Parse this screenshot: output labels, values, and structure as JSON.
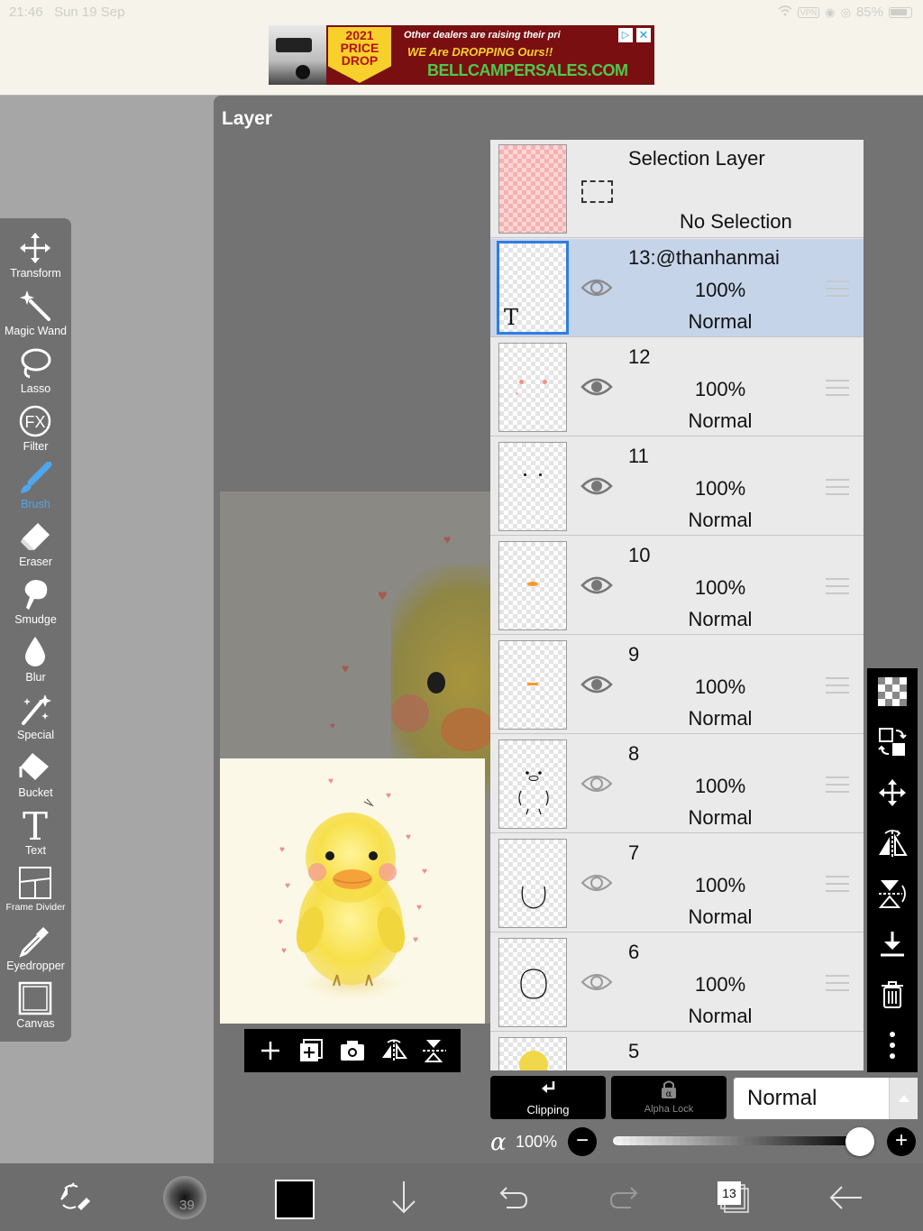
{
  "status_bar": {
    "time": "21:46",
    "date": "Sun 19 Sep",
    "battery": "85%",
    "vpn": "VPN"
  },
  "ad": {
    "badge_year": "2021",
    "badge_line2": "PRICE",
    "badge_line3": "DROP",
    "line1": "Other dealers are raising their pri",
    "line2": "WE Are DROPPING Ours!!",
    "line3": "BELLCAMPERSALES.COM"
  },
  "tools": [
    {
      "label": "Transform",
      "icon": "transform-icon"
    },
    {
      "label": "Magic Wand",
      "icon": "magic-wand-icon"
    },
    {
      "label": "Lasso",
      "icon": "lasso-icon"
    },
    {
      "label": "Filter",
      "icon": "filter-icon",
      "glyph": "FX"
    },
    {
      "label": "Brush",
      "icon": "brush-icon",
      "active": true
    },
    {
      "label": "Eraser",
      "icon": "eraser-icon"
    },
    {
      "label": "Smudge",
      "icon": "smudge-icon"
    },
    {
      "label": "Blur",
      "icon": "blur-icon"
    },
    {
      "label": "Special",
      "icon": "special-icon"
    },
    {
      "label": "Bucket",
      "icon": "bucket-icon"
    },
    {
      "label": "Text",
      "icon": "text-icon",
      "glyph": "T"
    },
    {
      "label": "Frame Divider",
      "icon": "frame-divider-icon"
    },
    {
      "label": "Eyedropper",
      "icon": "eyedropper-icon"
    },
    {
      "label": "Canvas",
      "icon": "canvas-icon"
    }
  ],
  "layer_panel": {
    "title": "Layer"
  },
  "selection_layer": {
    "name": "Selection Layer",
    "status": "No Selection"
  },
  "layers": [
    {
      "name": "13:@thanhanmai",
      "opacity": "100%",
      "mode": "Normal",
      "visible": true,
      "selected": true,
      "thumb_glyph": "T"
    },
    {
      "name": "12",
      "opacity": "100%",
      "mode": "Normal",
      "visible": true
    },
    {
      "name": "11",
      "opacity": "100%",
      "mode": "Normal",
      "visible": true
    },
    {
      "name": "10",
      "opacity": "100%",
      "mode": "Normal",
      "visible": true
    },
    {
      "name": "9",
      "opacity": "100%",
      "mode": "Normal",
      "visible": true
    },
    {
      "name": "8",
      "opacity": "100%",
      "mode": "Normal",
      "visible": false
    },
    {
      "name": "7",
      "opacity": "100%",
      "mode": "Normal",
      "visible": false
    },
    {
      "name": "6",
      "opacity": "100%",
      "mode": "Normal",
      "visible": false
    },
    {
      "name": "5",
      "opacity": "",
      "mode": "",
      "visible": false
    }
  ],
  "blend": {
    "clipping_label": "Clipping",
    "alpha_lock_label": "Alpha Lock",
    "alpha_lock_glyph": "α",
    "mode": "Normal",
    "alpha_symbol": "α",
    "opacity_label": "100%",
    "opacity": 1.0,
    "minus": "−",
    "plus": "+"
  },
  "bottom_bar": {
    "brush_size": "39",
    "layer_count": "13",
    "color": "#000000"
  },
  "colors": {
    "accent": "#2f7de1",
    "active_tool": "#4ea6ef",
    "selected_row": "#c6d4ea"
  }
}
